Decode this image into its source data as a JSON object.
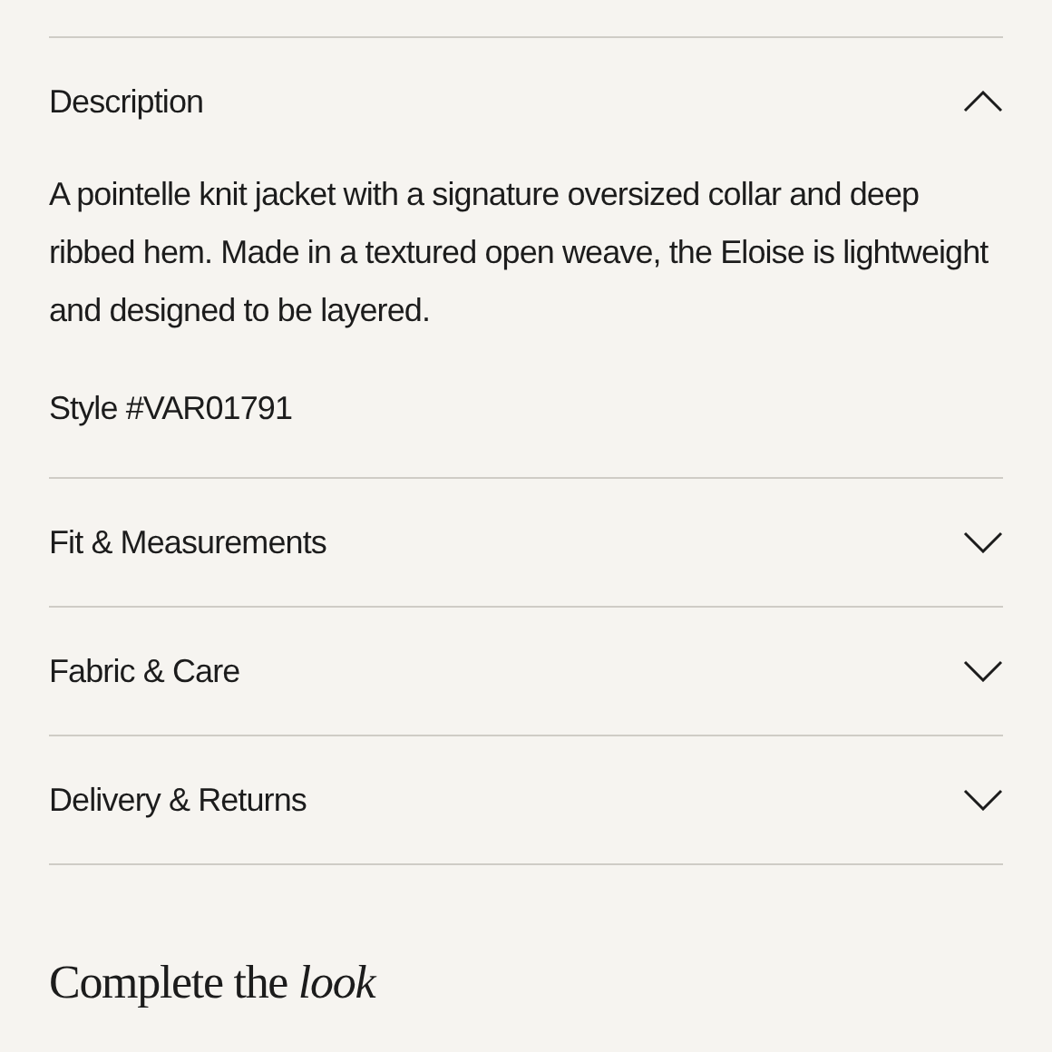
{
  "accordion": [
    {
      "title": "Description",
      "expanded": true,
      "body": "A pointelle knit jacket with a signature oversized collar and deep ribbed hem. Made in a textured open weave, the Eloise is lightweight and designed to be layered.",
      "style": "Style #VAR01791"
    },
    {
      "title": "Fit & Measurements",
      "expanded": false
    },
    {
      "title": "Fabric & Care",
      "expanded": false
    },
    {
      "title": "Delivery & Returns",
      "expanded": false
    }
  ],
  "heading": "Complete the *look*"
}
